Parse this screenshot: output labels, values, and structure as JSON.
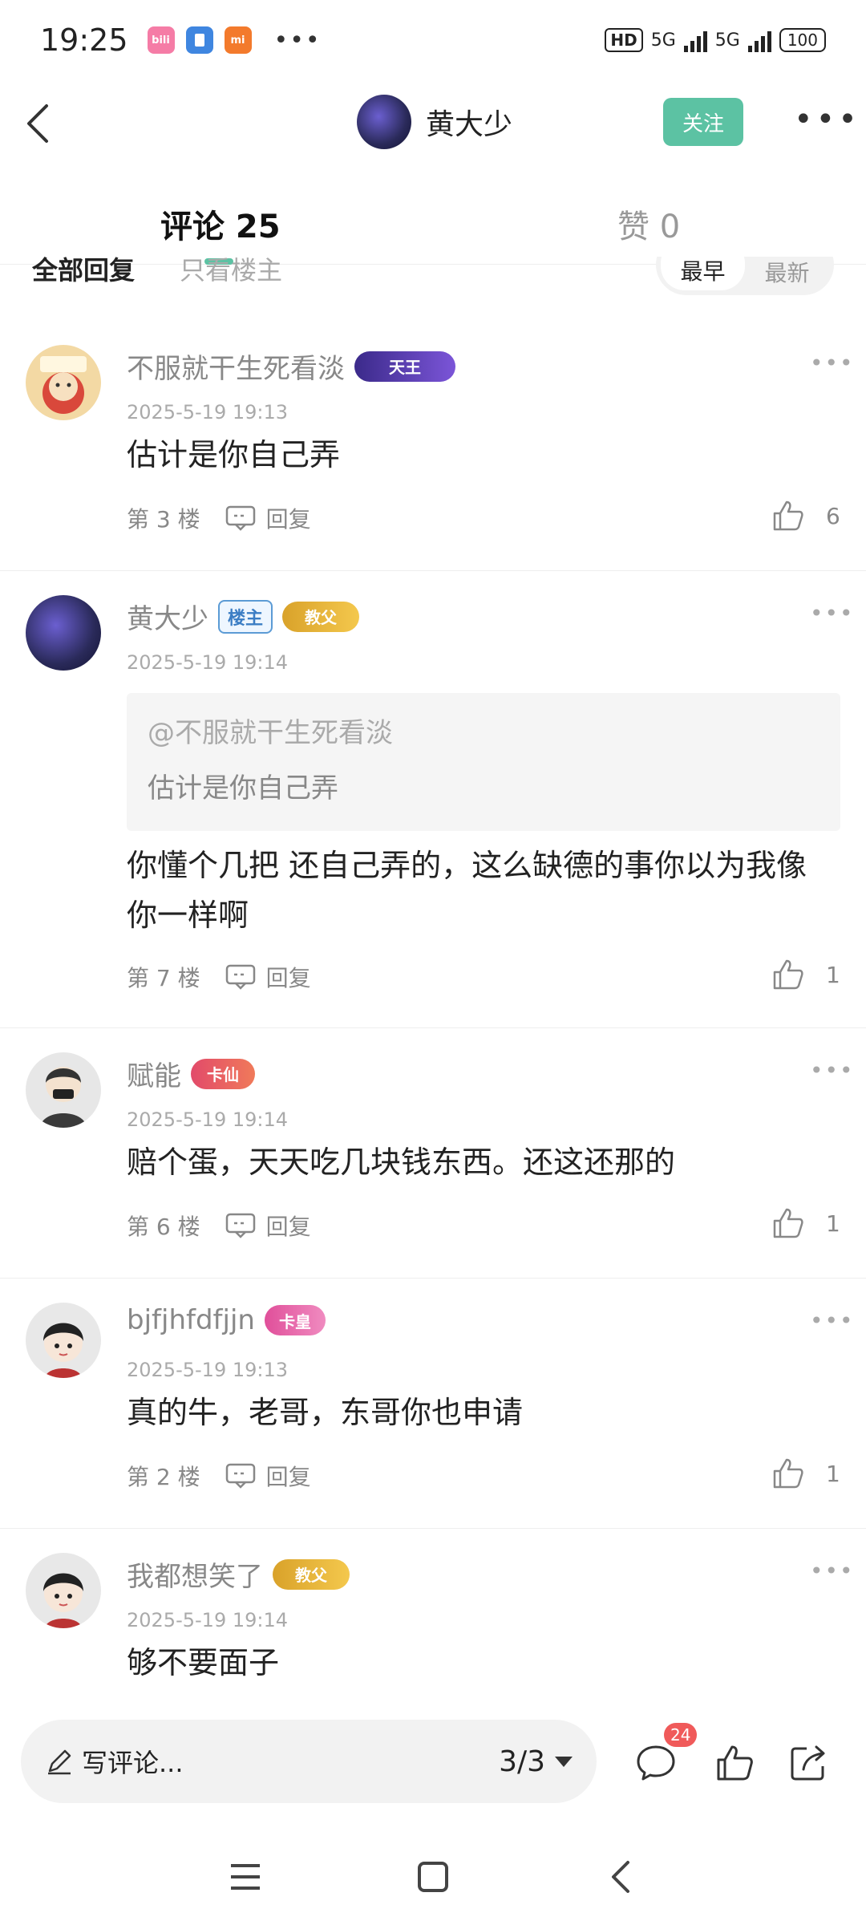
{
  "status_bar": {
    "time": "19:25",
    "app_icons": [
      {
        "name": "bilibili-icon",
        "label": "bili",
        "color": "#f57ca6"
      },
      {
        "name": "files-icon",
        "label": "",
        "color": "#3f86e0"
      },
      {
        "name": "mi-icon",
        "label": "mi",
        "color": "#f37a2c"
      }
    ],
    "hd": "HD",
    "network1": "5G",
    "network2": "5G",
    "battery": "100"
  },
  "header": {
    "author": "黄大少",
    "follow_label": "关注"
  },
  "tabs": {
    "comments": "评论 25",
    "likes": "赞 0"
  },
  "filters": {
    "all": "全部回复",
    "owner_only": "只看楼主",
    "sort_earliest": "最早",
    "sort_latest": "最新"
  },
  "reply_label": "回复",
  "comments": [
    {
      "user": "不服就干生死看淡",
      "badge": "天王",
      "time": "2025-5-19 19:13",
      "text": "估计是你自己弄",
      "floor": "第 3 楼",
      "likes": "6"
    },
    {
      "user": "黄大少",
      "owner_badge": "楼主",
      "badge": "教父",
      "time": "2025-5-19 19:14",
      "quote_user": "@不服就干生死看淡",
      "quote_text": "估计是你自己弄",
      "text": "你懂个几把  还自己弄的，这么缺德的事你以为我像你一样啊",
      "floor": "第 7 楼",
      "likes": "1"
    },
    {
      "user": "赋能",
      "badge": "卡仙",
      "time": "2025-5-19 19:14",
      "text": "赔个蛋，天天吃几块钱东西。还这还那的",
      "floor": "第 6 楼",
      "likes": "1"
    },
    {
      "user": "bjfjhfdfjjn",
      "badge": "卡皇",
      "time": "2025-5-19 19:13",
      "text": "真的牛，老哥，东哥你也申请",
      "floor": "第 2 楼",
      "likes": "1"
    },
    {
      "user": "我都想笑了",
      "badge": "教父",
      "time": "2025-5-19 19:14",
      "text": "够不要面子"
    }
  ],
  "bottom_bar": {
    "input_placeholder": "写评论...",
    "page": "3/3",
    "comment_count_badge": "24"
  },
  "colors": {
    "accent": "#5cc2a3",
    "badge_red": "#f05a5a"
  }
}
